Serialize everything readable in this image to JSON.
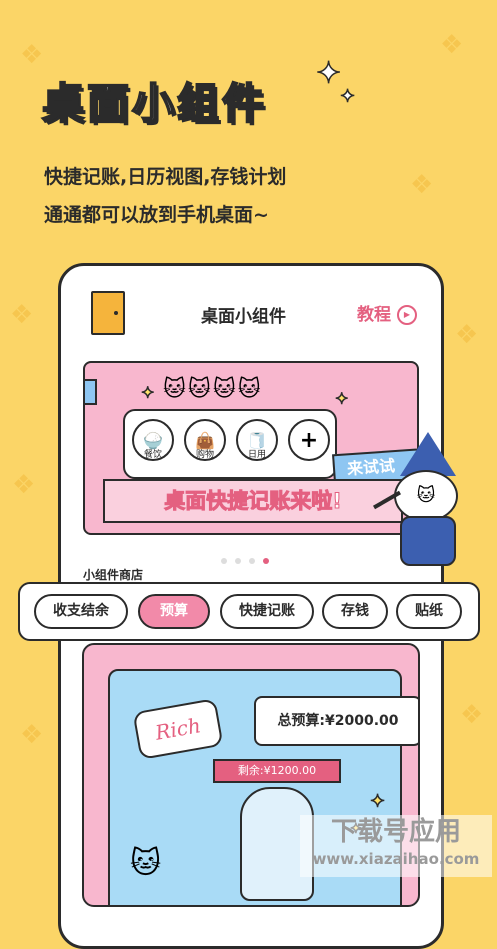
{
  "hero": {
    "title": "桌面小组件",
    "subtitle_line1": "快捷记账,日历视图,存钱计划",
    "subtitle_line2": "通通都可以放到手机桌面~"
  },
  "phone": {
    "title": "桌面小组件",
    "tutorial_label": "教程",
    "banner": {
      "icons": [
        {
          "label": "餐饮",
          "icon": "rice-bowl-icon"
        },
        {
          "label": "购物",
          "icon": "shopping-bag-icon"
        },
        {
          "label": "日用",
          "icon": "toilet-paper-icon"
        },
        {
          "label": "",
          "icon": "plus-icon"
        }
      ],
      "try_tag": "来试试",
      "strip_pre": "桌面",
      "strip_highlight": "快捷",
      "strip_post": "记账来啦!"
    },
    "carousel": {
      "count": 4,
      "active_index": 3
    },
    "shop_label": "小组件商店"
  },
  "chips": [
    {
      "label": "收支结余",
      "selected": false
    },
    {
      "label": "预算",
      "selected": true
    },
    {
      "label": "快捷记账",
      "selected": false
    },
    {
      "label": "存钱",
      "selected": false
    },
    {
      "label": "贴纸",
      "selected": false
    }
  ],
  "budget_card": {
    "badge": "Rich",
    "total_label": "总预算:¥2000.00",
    "remaining_label": "剩余:¥1200.00"
  },
  "watermark": {
    "line1": "下载号应用",
    "line2": "www.xiazaihao.com"
  },
  "colors": {
    "background": "#FBD567",
    "accent_pink": "#E46080",
    "chip_selected": "#F28AA9",
    "banner_pink": "#F8B7CE",
    "sky_blue": "#A9DBF6"
  }
}
